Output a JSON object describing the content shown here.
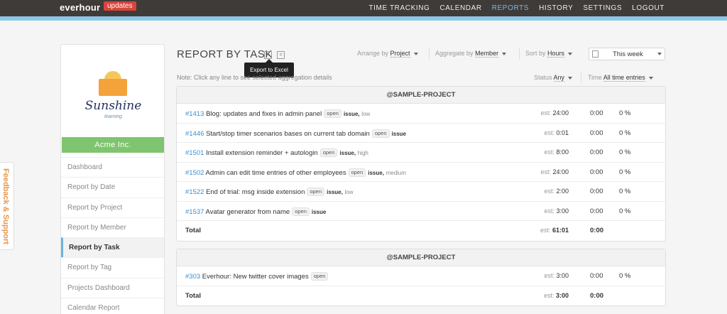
{
  "app": {
    "logo": "everhour",
    "updates_badge": "updates"
  },
  "nav": [
    {
      "label": "TIME TRACKING",
      "active": false
    },
    {
      "label": "CALENDAR",
      "active": false
    },
    {
      "label": "REPORTS",
      "active": true
    },
    {
      "label": "HISTORY",
      "active": false
    },
    {
      "label": "SETTINGS",
      "active": false
    },
    {
      "label": "LOGOUT",
      "active": false
    }
  ],
  "feedback_tab": "Feedback & Support",
  "sidebar": {
    "brand_name": "Sunshine",
    "brand_tagline": "learning",
    "company": "Acme Inc.",
    "items": [
      {
        "label": "Dashboard",
        "active": false
      },
      {
        "label": "Report by Date",
        "active": false
      },
      {
        "label": "Report by Project",
        "active": false
      },
      {
        "label": "Report by Member",
        "active": false
      },
      {
        "label": "Report by Task",
        "active": true
      },
      {
        "label": "Report by Tag",
        "active": false
      },
      {
        "label": "Projects Dashboard",
        "active": false
      },
      {
        "label": "Calendar Report",
        "active": false
      }
    ]
  },
  "header": {
    "title": "REPORT BY TASK",
    "export_tooltip": "Export to Excel",
    "note": "Note: Click any line to see selected aggregation details",
    "arrange_label": "Arrange by",
    "arrange_value": "Project",
    "aggregate_label": "Aggregate by",
    "aggregate_value": "Member",
    "sort_label": "Sort by",
    "sort_value": "Hours",
    "date_range": "This week",
    "status_label": "Status",
    "status_value": "Any",
    "time_label": "Time",
    "time_value": "All time entries"
  },
  "groups": [
    {
      "project": "@SAMPLE-PROJECT",
      "rows": [
        {
          "id": "#1413",
          "name": "Blog: updates and fixes in admin panel",
          "status": "open",
          "type": "issue,",
          "priority": "low",
          "est_label": "est:",
          "est": "24:00",
          "hours": "0:00",
          "percent": "0 %"
        },
        {
          "id": "#1446",
          "name": "Start/stop timer scenarios bases on current tab domain",
          "status": "open",
          "type": "issue",
          "priority": "",
          "est_label": "est:",
          "est": "0:01",
          "hours": "0:00",
          "percent": "0 %"
        },
        {
          "id": "#1501",
          "name": "Install extension reminder + autologin",
          "status": "open",
          "type": "issue,",
          "priority": "high",
          "est_label": "est:",
          "est": "8:00",
          "hours": "0:00",
          "percent": "0 %"
        },
        {
          "id": "#1502",
          "name": "Admin can edit time entries of other employees",
          "status": "open",
          "type": "issue,",
          "priority": "medium",
          "est_label": "est:",
          "est": "24:00",
          "hours": "0:00",
          "percent": "0 %"
        },
        {
          "id": "#1522",
          "name": "End of trial: msg inside extension",
          "status": "open",
          "type": "issue,",
          "priority": "low",
          "est_label": "est:",
          "est": "2:00",
          "hours": "0:00",
          "percent": "0 %"
        },
        {
          "id": "#1537",
          "name": "Avatar generator from name",
          "status": "open",
          "type": "issue",
          "priority": "",
          "est_label": "est:",
          "est": "3:00",
          "hours": "0:00",
          "percent": "0 %"
        }
      ],
      "total": {
        "label": "Total",
        "est_label": "est:",
        "est": "61:01",
        "hours": "0:00"
      }
    },
    {
      "project": "@SAMPLE-PROJECT",
      "rows": [
        {
          "id": "#303",
          "name": "Everhour: New twitter cover images",
          "status": "open",
          "type": "",
          "priority": "",
          "est_label": "est:",
          "est": "3:00",
          "hours": "0:00",
          "percent": "0 %"
        }
      ],
      "total": {
        "label": "Total",
        "est_label": "est:",
        "est": "3:00",
        "hours": "0:00"
      }
    }
  ]
}
